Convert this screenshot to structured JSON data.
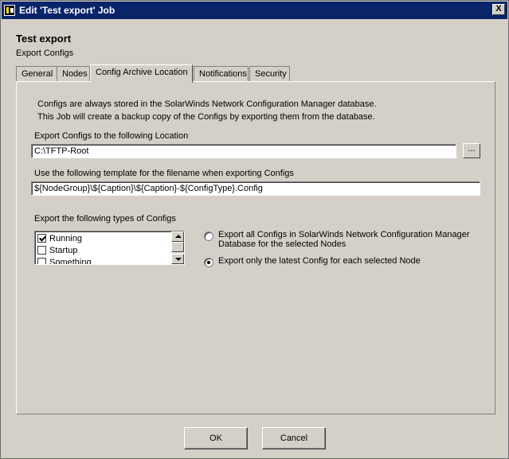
{
  "window": {
    "title": "Edit 'Test export' Job",
    "close_glyph": "X"
  },
  "header": {
    "title": "Test export",
    "subtitle": "Export Configs"
  },
  "tabs": [
    {
      "label": "General"
    },
    {
      "label": "Nodes"
    },
    {
      "label": "Config Archive Location",
      "active": true
    },
    {
      "label": "Notifications"
    },
    {
      "label": "Security"
    }
  ],
  "panel": {
    "info_line1": "Configs are always stored in the SolarWinds Network Configuration Manager database.",
    "info_line2": "This Job will create a backup copy of the Configs by exporting them from the database.",
    "location": {
      "label": "Export Configs to the following Location",
      "value": "C:\\TFTP-Root",
      "browse_label": "..."
    },
    "template": {
      "label": "Use the following template for the filename when exporting Configs",
      "value": "${NodeGroup}\\${Caption}\\${Caption}-${ConfigType}.Config"
    },
    "types": {
      "label": "Export the following types of Configs",
      "items": [
        {
          "label": "Running",
          "checked": true
        },
        {
          "label": "Startup",
          "checked": false
        },
        {
          "label": "Something",
          "checked": false
        }
      ]
    },
    "export_mode": {
      "option_all_line1": "Export all Configs in SolarWinds Network Configuration Manager",
      "option_all_line2": "Database for the selected Nodes",
      "option_latest": "Export only the latest Config for each selected Node",
      "selected": "latest"
    }
  },
  "footer": {
    "ok_label": "OK",
    "cancel_label": "Cancel"
  }
}
